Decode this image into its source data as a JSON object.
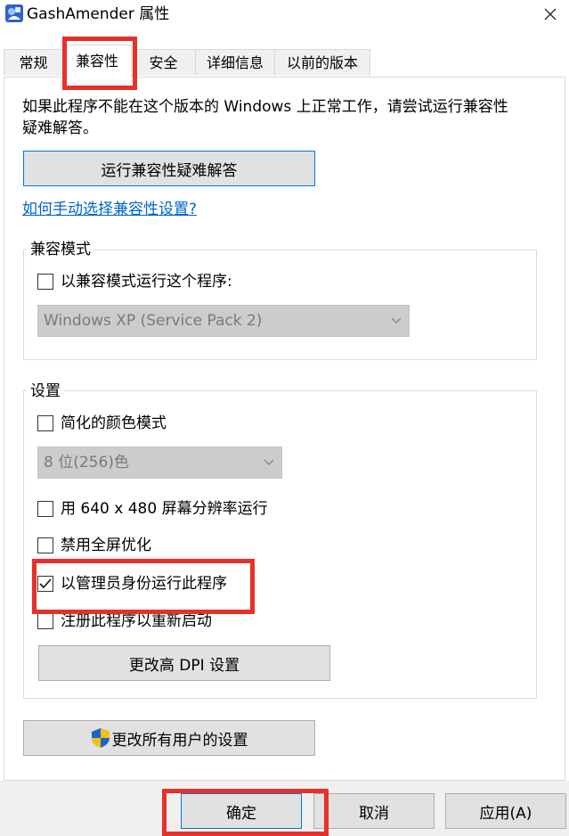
{
  "window": {
    "title": "GashAmender 属性",
    "icon": "app-icon",
    "close_icon": "close-icon"
  },
  "tabs": [
    {
      "label": "常规",
      "active": false
    },
    {
      "label": "兼容性",
      "active": true
    },
    {
      "label": "安全",
      "active": false
    },
    {
      "label": "详细信息",
      "active": false
    },
    {
      "label": "以前的版本",
      "active": false
    }
  ],
  "intro": {
    "line1": "如果此程序不能在这个版本的 Windows 上正常工作，请尝试运行兼容性",
    "line2": "疑难解答。"
  },
  "troubleshoot_button": "运行兼容性疑难解答",
  "manual_link": "如何手动选择兼容性设置?",
  "compat_mode": {
    "title": "兼容模式",
    "checkbox_label": "以兼容模式运行这个程序:",
    "checked": false,
    "os_select": "Windows XP (Service Pack 2)"
  },
  "settings": {
    "title": "设置",
    "reduced_color": {
      "label": "简化的颜色模式",
      "checked": false
    },
    "color_select": "8 位(256)色",
    "resolution": {
      "label": "用 640 x 480 屏幕分辨率运行",
      "checked": false
    },
    "disable_fullscreen": {
      "label": "禁用全屏优化",
      "checked": false
    },
    "run_as_admin": {
      "label": "以管理员身份运行此程序",
      "checked": true
    },
    "register_restart": {
      "label": "注册此程序以重新启动",
      "checked": false
    },
    "dpi_button": "更改高 DPI 设置"
  },
  "all_users_button": "更改所有用户的设置",
  "footer": {
    "ok": "确定",
    "cancel": "取消",
    "apply": "应用(A)"
  },
  "colors": {
    "accent": "#0078d7",
    "link": "#0066cc",
    "highlight": "#e8302a",
    "disabled_select": "#cccccc",
    "button": "#e1e1e1",
    "footer_bg": "#f0f0f0"
  }
}
